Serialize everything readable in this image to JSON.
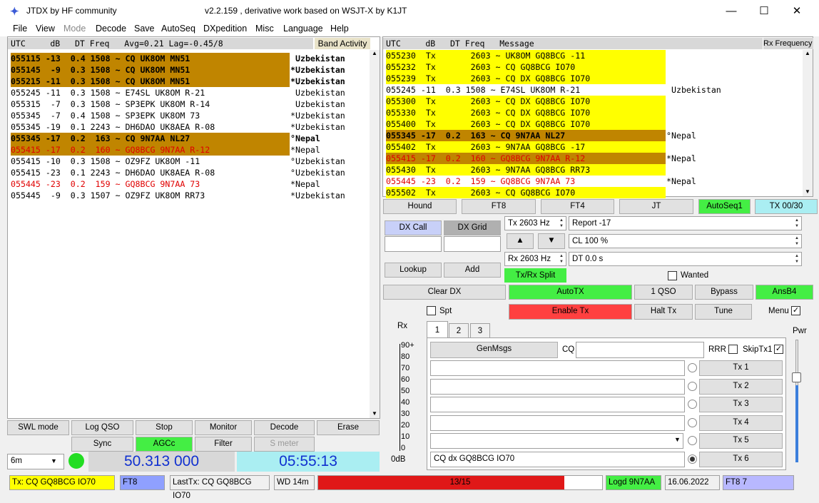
{
  "title": {
    "app": "JTDX  by HF community",
    "version": "v2.2.159 , derivative work based on WSJT-X by K1JT"
  },
  "menu": [
    "File",
    "View",
    "Mode",
    "Decode",
    "Save",
    "AutoSeq",
    "DXpedition",
    "Misc",
    "Language",
    "Help"
  ],
  "band": {
    "header": "UTC     dB   DT Freq   Avg=0.21 Lag=-0.45/8",
    "title": "Band Activity",
    "rows": [
      {
        "text": "055115 -13  0.4 1508 ~ CQ UK8OM MN51",
        "ctry": " Uzbekistan",
        "style": "brn bold"
      },
      {
        "text": "055145  -9  0.3 1508 ~ CQ UK8OM MN51",
        "ctry": "*Uzbekistan",
        "style": "brn bold"
      },
      {
        "text": "055215 -11  0.3 1508 ~ CQ UK8OM MN51",
        "ctry": "*Uzbekistan",
        "style": "brn bold"
      },
      {
        "text": "055245 -11  0.3 1508 ~ E74SL UK8OM R-21",
        "ctry": " Uzbekistan",
        "style": ""
      },
      {
        "text": "055315  -7  0.3 1508 ~ SP3EPK UK8OM R-14",
        "ctry": " Uzbekistan",
        "style": ""
      },
      {
        "text": "055345  -7  0.4 1508 ~ SP3EPK UK8OM 73",
        "ctry": "*Uzbekistan",
        "style": ""
      },
      {
        "text": "055345 -19  0.1 2243 ~ DH6DAO UK8AEA R-08",
        "ctry": "*Uzbekistan",
        "style": ""
      },
      {
        "text": "055345 -17  0.2  163 ~ CQ 9N7AA NL27",
        "ctry": "°Nepal",
        "style": "brn bold"
      },
      {
        "text": "055415 -17  0.2  160 ~ GQ8BCG 9N7AA R-12",
        "ctry": "*Nepal",
        "style": "brn red"
      },
      {
        "text": "055415 -10  0.3 1508 ~ OZ9FZ UK8OM -11",
        "ctry": "°Uzbekistan",
        "style": ""
      },
      {
        "text": "055415 -23  0.1 2243 ~ DH6DAO UK8AEA R-08",
        "ctry": "°Uzbekistan",
        "style": ""
      },
      {
        "text": "055445 -23  0.2  159 ~ GQ8BCG 9N7AA 73",
        "ctry": "*Nepal",
        "style": "red"
      },
      {
        "text": "055445  -9  0.3 1507 ~ OZ9FZ UK8OM RR73",
        "ctry": "*Uzbekistan",
        "style": ""
      }
    ]
  },
  "rx": {
    "header": "UTC     dB   DT Freq   Message",
    "title": "Rx Frequency",
    "rows": [
      {
        "text": "055230  Tx       2603 ~ UK8OM GQ8BCG -11",
        "ctry": "",
        "style": "yel"
      },
      {
        "text": "055232  Tx       2603 ~ CQ GQ8BCG IO70",
        "ctry": "",
        "style": "yel"
      },
      {
        "text": "055239  Tx       2603 ~ CQ DX GQ8BCG IO70",
        "ctry": "",
        "style": "yel"
      },
      {
        "text": "055245 -11  0.3 1508 ~ E74SL UK8OM R-21",
        "ctry": " Uzbekistan",
        "style": ""
      },
      {
        "text": "055300  Tx       2603 ~ CQ DX GQ8BCG IO70",
        "ctry": "",
        "style": "yel"
      },
      {
        "text": "055330  Tx       2603 ~ CQ DX GQ8BCG IO70",
        "ctry": "",
        "style": "yel"
      },
      {
        "text": "055400  Tx       2603 ~ CQ DX GQ8BCG IO70",
        "ctry": "",
        "style": "yel"
      },
      {
        "text": "055345 -17  0.2  163 ~ CQ 9N7AA NL27",
        "ctry": "°Nepal",
        "style": "brn bold"
      },
      {
        "text": "055402  Tx       2603 ~ 9N7AA GQ8BCG -17",
        "ctry": "",
        "style": "yel"
      },
      {
        "text": "055415 -17  0.2  160 ~ GQ8BCG 9N7AA R-12",
        "ctry": "*Nepal",
        "style": "brn red"
      },
      {
        "text": "055430  Tx       2603 ~ 9N7AA GQ8BCG RR73",
        "ctry": "",
        "style": "yel"
      },
      {
        "text": "055445 -23  0.2  159 ~ GQ8BCG 9N7AA 73",
        "ctry": "*Nepal",
        "style": "red"
      },
      {
        "text": "055502  Tx       2603 ~ CQ GQ8BCG IO70",
        "ctry": "",
        "style": "yel"
      }
    ]
  },
  "left_buttons": {
    "swl": "SWL mode",
    "logqso": "Log QSO",
    "stop": "Stop",
    "monitor": "Monitor",
    "decode": "Decode",
    "erase": "Erase",
    "sync": "Sync",
    "agcc": "AGCc",
    "filter": "Filter",
    "smeter": "S meter"
  },
  "band_select": "6m",
  "freq": "50.313 000",
  "clock": "05:55:13",
  "mode_buttons": {
    "hound": "Hound",
    "ft8": "FT8",
    "ft4": "FT4",
    "jt": "JT",
    "autoseq": "AutoSeq1",
    "tx": "TX 00/30"
  },
  "dx": {
    "call": "DX Call",
    "grid": "DX Grid",
    "lookup": "Lookup",
    "add": "Add"
  },
  "controls": {
    "txhz": "Tx  2603  Hz",
    "rxhz": "Rx  2603  Hz",
    "report": "Report -17",
    "cl": "CL  100 %",
    "dt": "DT 0.0 s",
    "split": "Tx/Rx Split",
    "wanted": "Wanted"
  },
  "actions": {
    "cleardx": "Clear DX",
    "autotx": "AutoTX",
    "oneqso": "1 QSO",
    "bypass": "Bypass",
    "ansb4": "AnsB4",
    "spt": "Spt",
    "enabletx": "Enable Tx",
    "halttx": "Halt Tx",
    "tune": "Tune",
    "menu": "Menu"
  },
  "tabs": [
    "1",
    "2",
    "3"
  ],
  "rx_label": "Rx",
  "pwr_label": "Pwr",
  "meter": {
    "scale": [
      "90+",
      "80",
      "70",
      "60",
      "50",
      "40",
      "30",
      "20",
      "10",
      "0"
    ],
    "db": "0dB"
  },
  "genmsgs": "GenMsgs",
  "cq_label": "CQ",
  "rrr": "RRR",
  "skiptx1": "SkipTx1",
  "tx_buttons": [
    "Tx 1",
    "Tx 2",
    "Tx 3",
    "Tx 4",
    "Tx 5",
    "Tx 6"
  ],
  "tx6_msg": "CQ dx GQ8BCG IO70",
  "status": {
    "txmsg": "Tx: CQ GQ8BCG IO70",
    "mode": "FT8",
    "lasttx": "LastTx: CQ GQ8BCG IO70",
    "wd": "WD 14m",
    "progress_label": "13/15",
    "progress_fraction": 0.8667,
    "logd": "Logd 9N7AA",
    "date": "16.06.2022",
    "ftcount": "FT8  7"
  },
  "colors": {
    "activity": "#c08500",
    "tx": "#ffff00",
    "green": "#44ee44",
    "enable": "#ff4040",
    "cyan": "#aaeef2"
  }
}
